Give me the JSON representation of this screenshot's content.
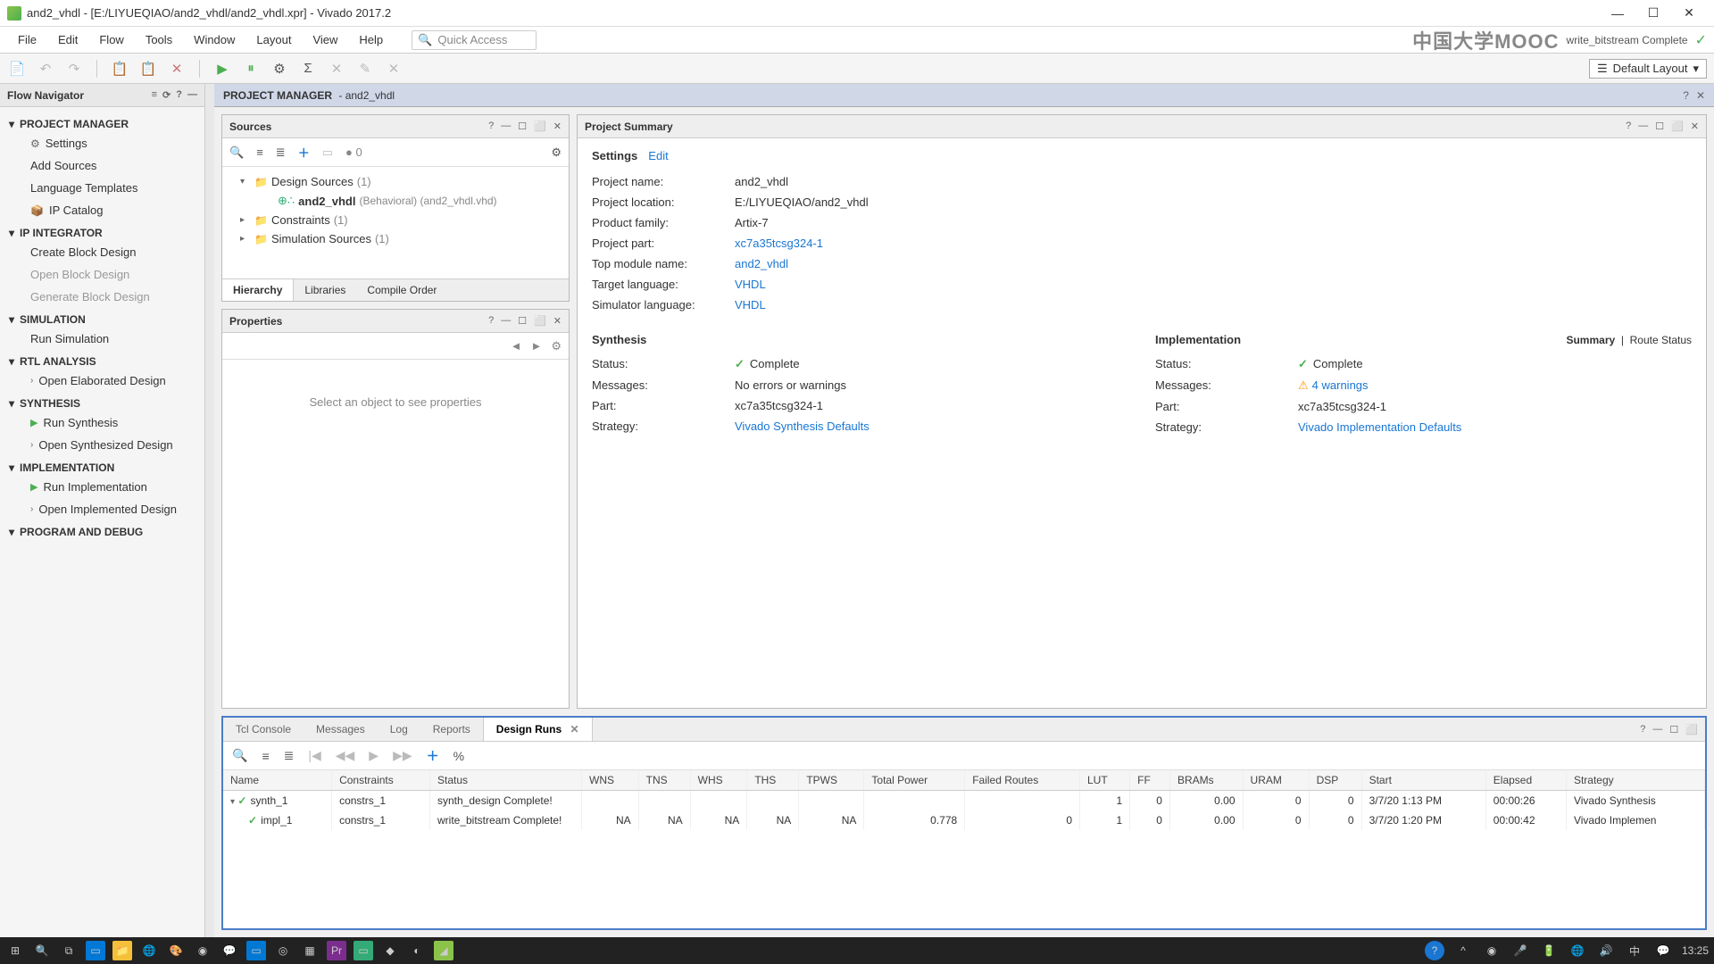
{
  "window": {
    "title": "and2_vhdl - [E:/LIYUEQIAO/and2_vhdl/and2_vhdl.xpr] - Vivado 2017.2",
    "status_top": "write_bitstream Complete"
  },
  "menu": {
    "file": "File",
    "edit": "Edit",
    "flow": "Flow",
    "tools": "Tools",
    "window": "Window",
    "layout": "Layout",
    "view": "View",
    "help": "Help",
    "quick_access": "Quick Access",
    "mooc": "中国大学MOOC",
    "default_layout": "Default Layout"
  },
  "flownav": {
    "title": "Flow Navigator",
    "pm": "PROJECT MANAGER",
    "settings": "Settings",
    "add_sources": "Add Sources",
    "lang_tpl": "Language Templates",
    "ip_catalog": "IP Catalog",
    "ip_int": "IP INTEGRATOR",
    "create_bd": "Create Block Design",
    "open_bd": "Open Block Design",
    "gen_bd": "Generate Block Design",
    "sim": "SIMULATION",
    "run_sim": "Run Simulation",
    "rtl": "RTL ANALYSIS",
    "open_elab": "Open Elaborated Design",
    "syn": "SYNTHESIS",
    "run_syn": "Run Synthesis",
    "open_syn": "Open Synthesized Design",
    "impl": "IMPLEMENTATION",
    "run_impl": "Run Implementation",
    "open_impl": "Open Implemented Design",
    "pnd": "PROGRAM AND DEBUG"
  },
  "pm": {
    "header": "PROJECT MANAGER",
    "proj": "and2_vhdl"
  },
  "sources": {
    "title": "Sources",
    "msg_count": "0",
    "design_sources": "Design Sources",
    "ds_count": "(1)",
    "top_module": "and2_vhdl",
    "behav": "(Behavioral) (and2_vhdl.vhd)",
    "constraints": "Constraints",
    "c_count": "(1)",
    "sim_sources": "Simulation Sources",
    "s_count": "(1)",
    "tab_hierarchy": "Hierarchy",
    "tab_libraries": "Libraries",
    "tab_compile": "Compile Order"
  },
  "properties": {
    "title": "Properties",
    "empty": "Select an object to see properties"
  },
  "summary": {
    "title": "Project Summary",
    "settings_hdr": "Settings",
    "edit": "Edit",
    "proj_name_l": "Project name:",
    "proj_name_v": "and2_vhdl",
    "proj_loc_l": "Project location:",
    "proj_loc_v": "E:/LIYUEQIAO/and2_vhdl",
    "prod_fam_l": "Product family:",
    "prod_fam_v": "Artix-7",
    "proj_part_l": "Project part:",
    "proj_part_v": "xc7a35tcsg324-1",
    "top_mod_l": "Top module name:",
    "top_mod_v": "and2_vhdl",
    "tgt_lang_l": "Target language:",
    "tgt_lang_v": "VHDL",
    "sim_lang_l": "Simulator language:",
    "sim_lang_v": "VHDL",
    "syn_hdr": "Synthesis",
    "impl_hdr": "Implementation",
    "impl_tab_summary": "Summary",
    "impl_tab_route": "Route Status",
    "status_l": "Status:",
    "syn_status": "Complete",
    "impl_status": "Complete",
    "msg_l": "Messages:",
    "syn_msg": "No errors or warnings",
    "impl_msg": "4 warnings",
    "part_l": "Part:",
    "syn_part": "xc7a35tcsg324-1",
    "impl_part": "xc7a35tcsg324-1",
    "strat_l": "Strategy:",
    "syn_strat": "Vivado Synthesis Defaults",
    "impl_strat": "Vivado Implementation Defaults"
  },
  "bottom": {
    "tab_tcl": "Tcl Console",
    "tab_msg": "Messages",
    "tab_log": "Log",
    "tab_rep": "Reports",
    "tab_runs": "Design Runs",
    "cols": {
      "name": "Name",
      "constraints": "Constraints",
      "status": "Status",
      "wns": "WNS",
      "tns": "TNS",
      "whs": "WHS",
      "ths": "THS",
      "tpws": "TPWS",
      "power": "Total Power",
      "failed": "Failed Routes",
      "lut": "LUT",
      "ff": "FF",
      "brams": "BRAMs",
      "uram": "URAM",
      "dsp": "DSP",
      "start": "Start",
      "elapsed": "Elapsed",
      "strategy": "Strategy"
    },
    "rows": [
      {
        "name": "synth_1",
        "constraints": "constrs_1",
        "status": "synth_design Complete!",
        "wns": "",
        "tns": "",
        "whs": "",
        "ths": "",
        "tpws": "",
        "power": "",
        "failed": "",
        "lut": "1",
        "ff": "0",
        "brams": "0.00",
        "uram": "0",
        "dsp": "0",
        "start": "3/7/20 1:13 PM",
        "elapsed": "00:00:26",
        "strategy": "Vivado Synthesis"
      },
      {
        "name": "impl_1",
        "constraints": "constrs_1",
        "status": "write_bitstream Complete!",
        "wns": "NA",
        "tns": "NA",
        "whs": "NA",
        "ths": "NA",
        "tpws": "NA",
        "power": "0.778",
        "failed": "0",
        "lut": "1",
        "ff": "0",
        "brams": "0.00",
        "uram": "0",
        "dsp": "0",
        "start": "3/7/20 1:20 PM",
        "elapsed": "00:00:42",
        "strategy": "Vivado Implemen"
      }
    ]
  },
  "taskbar": {
    "time": "13:25"
  }
}
